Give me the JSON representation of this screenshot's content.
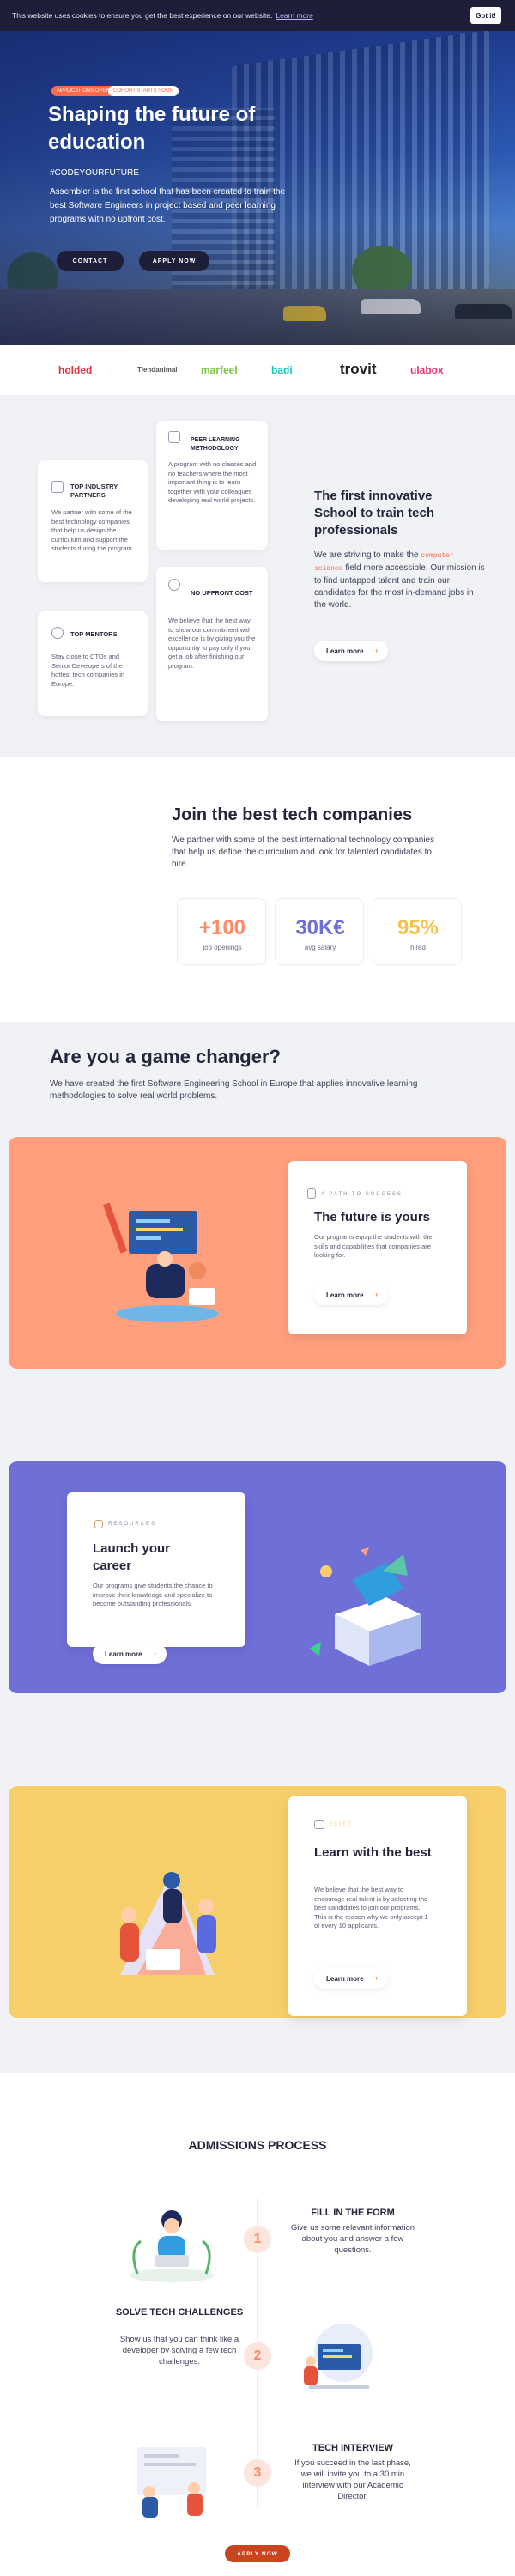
{
  "cookie": {
    "text": "This website uses cookies to ensure you get the best experience on our website.",
    "link": "Learn more",
    "button": "Got it!"
  },
  "hero": {
    "pill_a": "APPLICATIONS OPEN",
    "pill_b": "COHORT STARTS SOON",
    "title": "Shaping the future of education",
    "tag": "#CODEYOURFUTURE",
    "desc": "Assembler is the first school that has been created to train the best Software Engineers in project based and peer learning programs with no upfront cost.",
    "contact": "CONTACT",
    "apply": "APPLY NOW"
  },
  "logos": [
    "holded",
    "Tiendanimal",
    "marfeel",
    "badi",
    "trovit",
    "ulabox"
  ],
  "colors": {
    "accent": "#ff6b4a",
    "dark": "#1e1e38",
    "salmon": "#ff9f7d",
    "purple": "#6f6fd8",
    "yellow": "#f7cf6a"
  },
  "features": {
    "industry_title": "TOP INDUSTRY PARTNERS",
    "industry_text": "We partner with some of the best technology companies that help us design the curriculum and support the students during the program.",
    "mentors_title": "TOP MENTORS",
    "mentors_text": "Stay close to CTOs and Senior Developers of the hottest tech companies in Europe.",
    "peer_title": "PEER LEARNING METHODOLOGY",
    "peer_text": "A program with no classes and no teachers where the most important thing is to learn together with your colleagues developing real world projects.",
    "upfront_title": "NO UPFRONT COST",
    "upfront_text": "We believe that the best way to show our commitment with excellence is by giving you the opportunity to pay only if you get a job after finishing our program.",
    "main_title": "The first innovative School to train tech professionals",
    "main_text_a": "We are striving to make the",
    "main_code": "computer science",
    "main_text_b": "field more accessible. Our mission is to find untapped talent and train our candidates for the most in-demand jobs in the world.",
    "learn_more": "Learn more"
  },
  "join": {
    "title": "Join the best tech companies",
    "text": "We partner with some of the best international technology companies that help us define the curriculum and look for talented candidates to hire.",
    "stats": [
      {
        "value": "+100",
        "label": "job openings",
        "color": "#ff8a63"
      },
      {
        "value": "30K€",
        "label": "avg salary",
        "color": "#6f6fd8"
      },
      {
        "value": "95%",
        "label": "hired",
        "color": "#f5c24a"
      }
    ]
  },
  "game": {
    "title": "Are you a game changer?",
    "text": "We have created the first Software Engineering School in Europe that applies innovative learning methodologies to solve real world problems.",
    "panels": [
      {
        "eyebrow": "A PATH TO SUCCESS",
        "title": "The future is yours",
        "text": "Our programs equip the students with the skills and capabilities that companies are looking for.",
        "button": "Learn more"
      },
      {
        "eyebrow": "RESOURCES",
        "title": "Launch your career",
        "text": "Our programs give students the chance to improve their knowledge and specialize to become outstanding professionals.",
        "button": "Learn more"
      },
      {
        "eyebrow": "ELITE",
        "title": "Learn with the best",
        "text": "We believe that the best way to encourage real talent is by selecting the best candidates to join our programs. This is the reason why we only accept 1 of every 10 applicants.",
        "button": "Learn more"
      }
    ]
  },
  "admissions": {
    "title": "ADMISSIONS PROCESS",
    "steps": [
      {
        "num": "1",
        "title": "FILL IN THE FORM",
        "text": "Give us some relevant information about you and answer a few questions."
      },
      {
        "num": "2",
        "title": "SOLVE TECH CHALLENGES",
        "text": "Show us that you can think like a developer by solving a few tech challenges."
      },
      {
        "num": "3",
        "title": "TECH INTERVIEW",
        "text": "If you succeed in the last phase, we will invite you to a 30 min interview with our Academic Director."
      }
    ],
    "button": "APPLY NOW"
  }
}
